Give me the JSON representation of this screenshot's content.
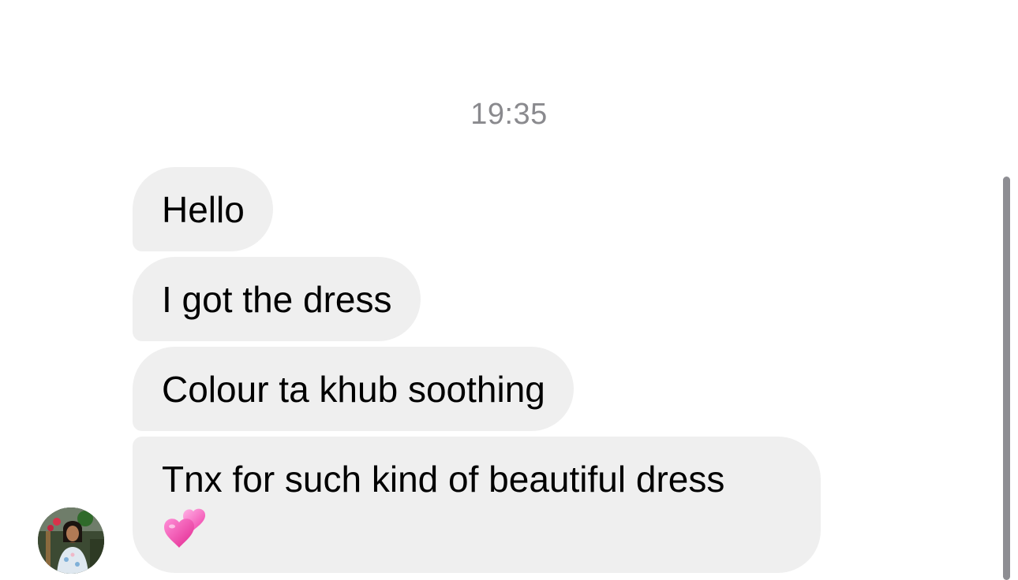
{
  "conversation": {
    "timestamp": "19:35",
    "messages": [
      {
        "text": "Hello"
      },
      {
        "text": "I got the dress"
      },
      {
        "text": "Colour ta khub soothing"
      },
      {
        "text": "Tnx for such kind of beautiful dress",
        "emoji": "💞"
      }
    ]
  },
  "sender": {
    "avatar_icon": "profile-photo"
  },
  "colors": {
    "bubble_background": "#efefef",
    "timestamp_text": "#8a8a8e",
    "heart_pink": "#ff4fb8"
  }
}
